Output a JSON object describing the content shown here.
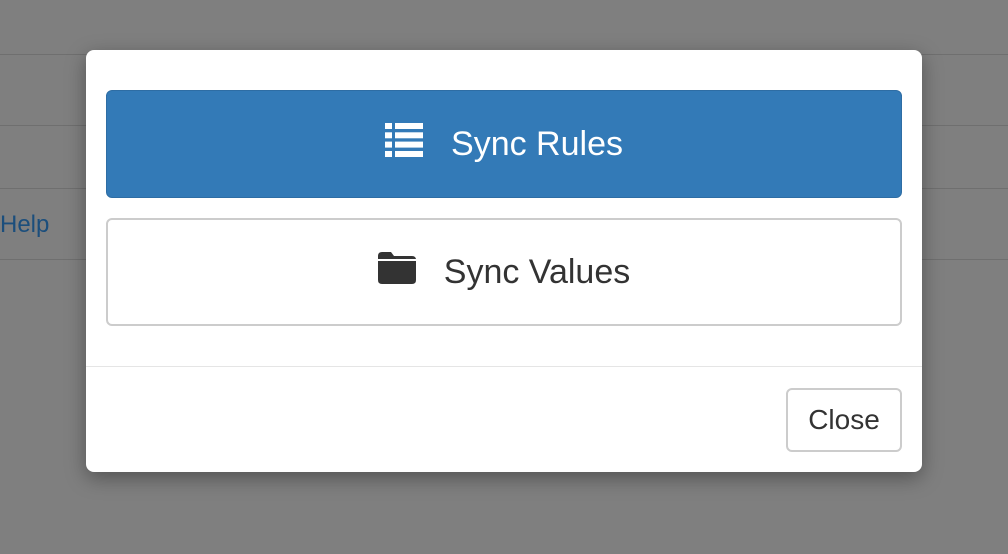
{
  "background": {
    "link_text": "Help",
    "overlay_color": "#7f7f7f"
  },
  "modal": {
    "buttons": [
      {
        "label": "Sync Rules",
        "icon": "list-icon",
        "style": "primary",
        "color": "#337ab7"
      },
      {
        "label": "Sync Values",
        "icon": "folder-icon",
        "style": "default"
      }
    ],
    "footer": {
      "close_label": "Close"
    }
  }
}
